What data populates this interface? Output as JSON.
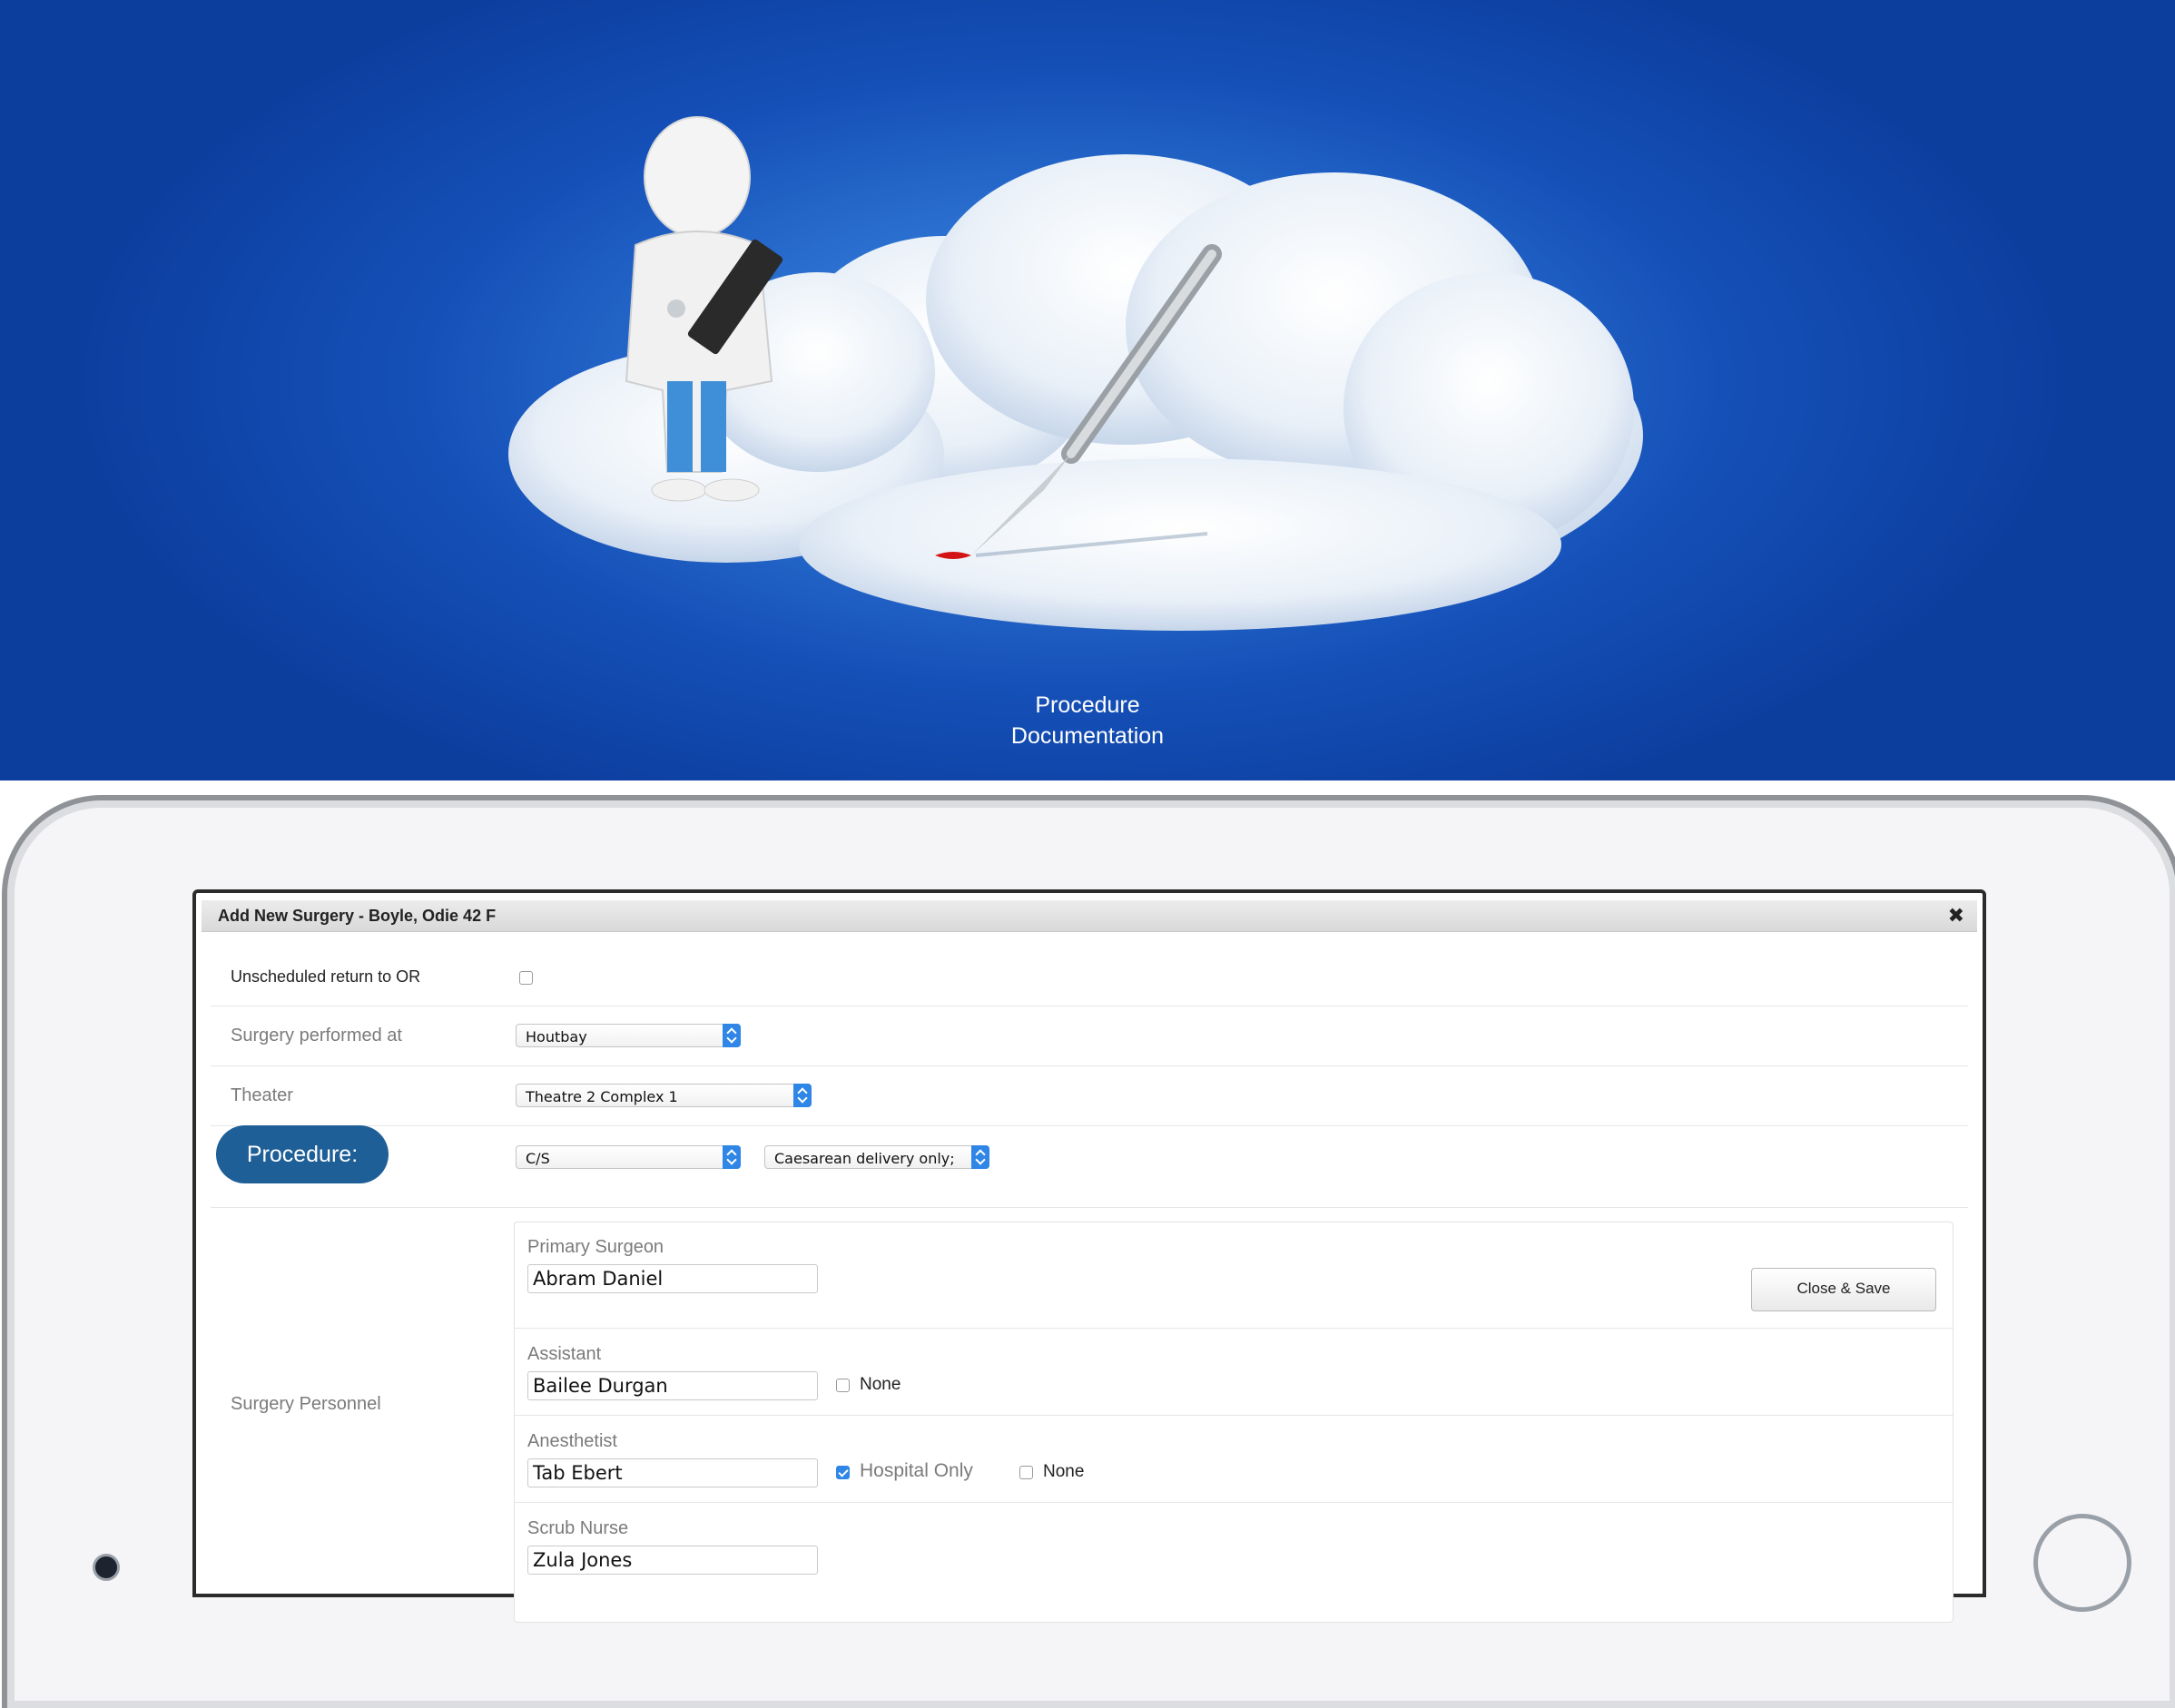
{
  "hero": {
    "caption_line1": "Procedure",
    "caption_line2": "Documentation"
  },
  "dialog": {
    "title": "Add New Surgery - Boyle, Odie 42 F",
    "close_glyph": "✖"
  },
  "form": {
    "unscheduled": {
      "label": "Unscheduled return to OR",
      "checked": false
    },
    "performed_at": {
      "label": "Surgery performed at",
      "value": "Houtbay"
    },
    "theater": {
      "label": "Theater",
      "value": "Theatre 2 Complex 1"
    },
    "procedure": {
      "label": "Procedure:",
      "code": "C/S",
      "description": "Caesarean delivery only;"
    },
    "personnel_label": "Surgery Personnel"
  },
  "personnel": {
    "primary_surgeon": {
      "label": "Primary Surgeon",
      "value": "Abram Daniel",
      "button": "Close & Save"
    },
    "assistant": {
      "label": "Assistant",
      "value": "Bailee Durgan",
      "none_label": "None",
      "none_checked": false
    },
    "anesthetist": {
      "label": "Anesthetist",
      "value": "Tab Ebert",
      "hospital_only_label": "Hospital Only",
      "hospital_only_checked": true,
      "none_label": "None",
      "none_checked": false
    },
    "scrub_nurse": {
      "label": "Scrub Nurse",
      "value": "Zula Jones"
    }
  },
  "colors": {
    "accent": "#2f86e6",
    "pill": "#1f5f97",
    "sky": "#1550b8"
  }
}
